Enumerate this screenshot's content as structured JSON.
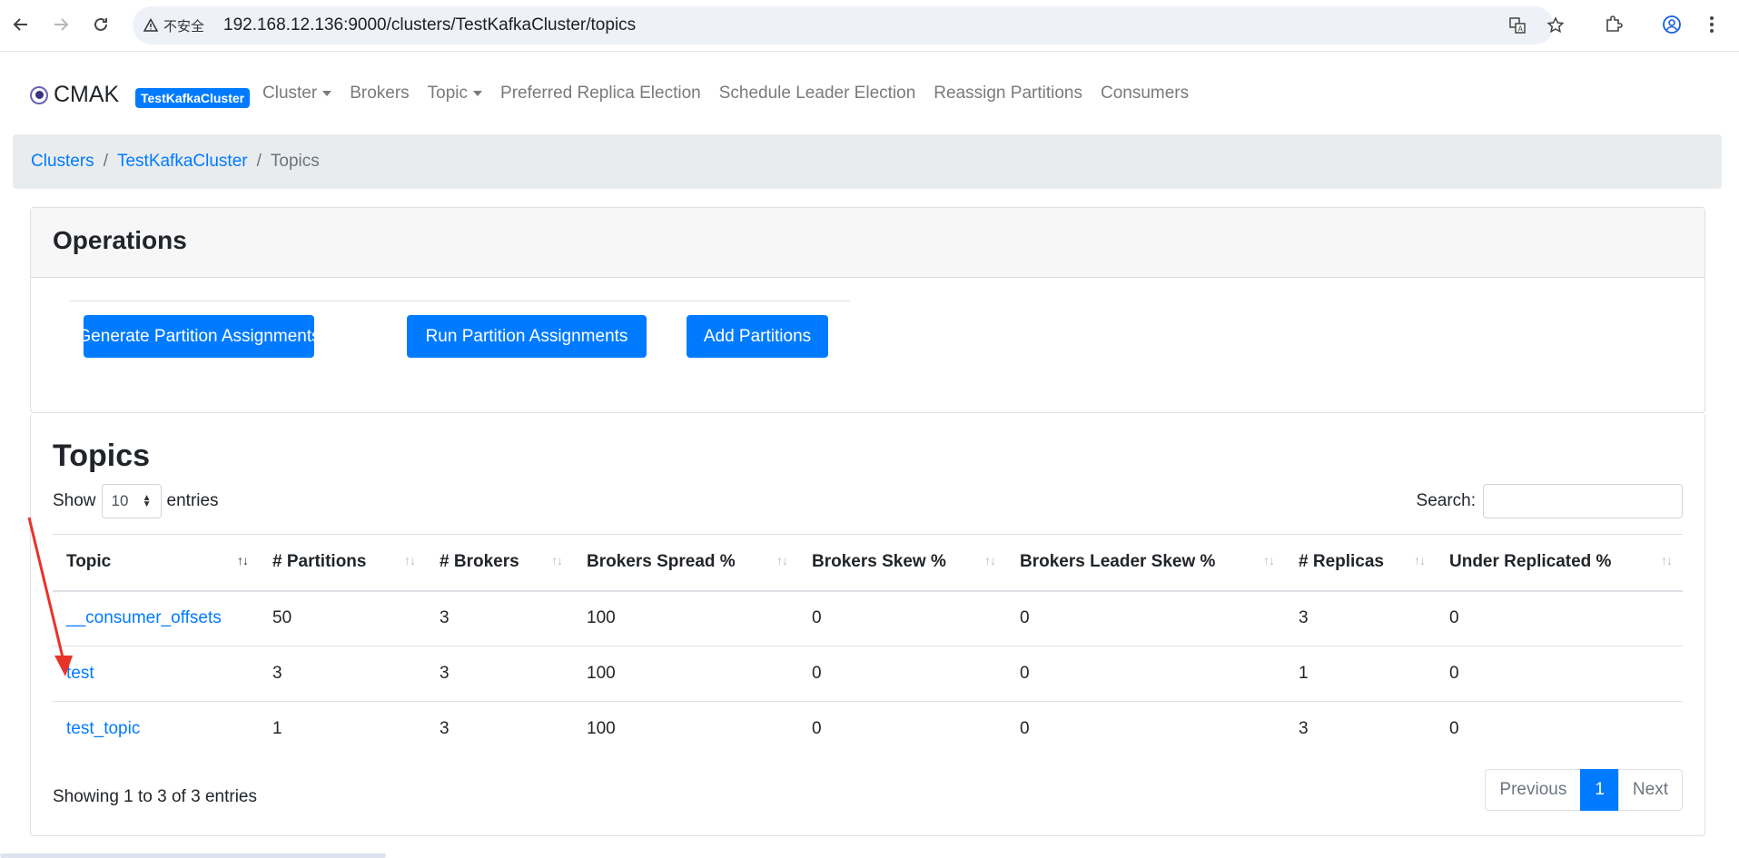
{
  "browser": {
    "secure_label": "不安全",
    "url": "192.168.12.136:9000/clusters/TestKafkaCluster/topics"
  },
  "navbar": {
    "brand": "CMAK",
    "cluster_badge": "TestKafkaCluster",
    "items": [
      {
        "label": "Cluster",
        "dropdown": true
      },
      {
        "label": "Brokers",
        "dropdown": false
      },
      {
        "label": "Topic",
        "dropdown": true
      },
      {
        "label": "Preferred Replica Election",
        "dropdown": false
      },
      {
        "label": "Schedule Leader Election",
        "dropdown": false
      },
      {
        "label": "Reassign Partitions",
        "dropdown": false
      },
      {
        "label": "Consumers",
        "dropdown": false
      }
    ]
  },
  "breadcrumb": {
    "items": [
      "Clusters",
      "TestKafkaCluster"
    ],
    "active": "Topics"
  },
  "operations": {
    "title": "Operations",
    "buttons": [
      "Generate Partition Assignments",
      "Run Partition Assignments",
      "Add Partitions"
    ]
  },
  "topics": {
    "title": "Topics",
    "show_label": "Show",
    "entries_label": "entries",
    "page_size": "10",
    "search_label": "Search:",
    "search_value": "",
    "columns": [
      "Topic",
      "# Partitions",
      "# Brokers",
      "Brokers Spread %",
      "Brokers Skew %",
      "Brokers Leader Skew %",
      "# Replicas",
      "Under Replicated %"
    ],
    "rows": [
      [
        "__consumer_offsets",
        "50",
        "3",
        "100",
        "0",
        "0",
        "3",
        "0"
      ],
      [
        "test",
        "3",
        "3",
        "100",
        "0",
        "0",
        "1",
        "0"
      ],
      [
        "test_topic",
        "1",
        "3",
        "100",
        "0",
        "0",
        "3",
        "0"
      ]
    ],
    "info": "Showing 1 to 3 of 3 entries",
    "pagination": {
      "previous": "Previous",
      "current": "1",
      "next": "Next"
    }
  },
  "colors": {
    "primary": "#007bff",
    "annotation_arrow": "#e8332a"
  }
}
